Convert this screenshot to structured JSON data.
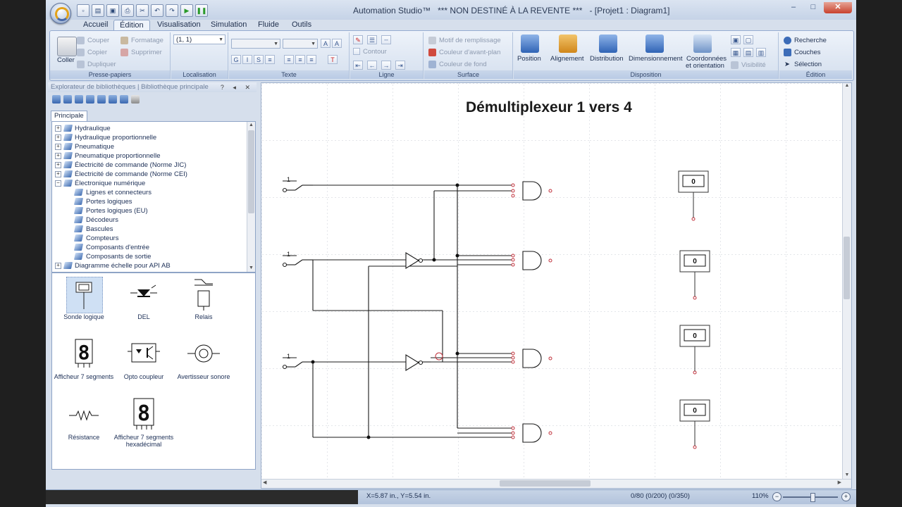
{
  "window": {
    "title": "Automation Studio™   *** NON DESTINÉ À LA REVENTE ***   - [Projet1 : Diagram1]",
    "controls": [
      "–",
      "□",
      "✕"
    ]
  },
  "tabs": [
    "Accueil",
    "Édition",
    "Visualisation",
    "Simulation",
    "Fluide",
    "Outils"
  ],
  "active_tab": "Édition",
  "ribbon": {
    "clipboard": {
      "label": "Presse-papiers",
      "paste": "Coller",
      "cut": "Couper",
      "copy": "Copier",
      "duplicate": "Dupliquer",
      "format": "Formatage",
      "delete": "Supprimer"
    },
    "location": {
      "label": "Localisation",
      "value": "(1, 1)"
    },
    "text": {
      "label": "Texte"
    },
    "line": {
      "label": "Ligne",
      "contour": "Contour"
    },
    "surface": {
      "label": "Surface",
      "fill_pattern": "Motif de remplissage",
      "foreground": "Couleur d'avant-plan",
      "background": "Couleur de fond"
    },
    "layout": {
      "label": "Disposition",
      "position": "Position",
      "alignment": "Alignement",
      "distribution": "Distribution",
      "sizing": "Dimensionnement",
      "coords_1": "Coordonnées",
      "coords_2": "et orientation",
      "visibility": "Visibilité"
    },
    "edition": {
      "label": "Édition",
      "search": "Recherche",
      "layers": "Couches",
      "selection": "Sélection"
    }
  },
  "library": {
    "header": "Explorateur de bibliothèques | Bibliothèque principale",
    "tab": "Principale",
    "tree": [
      {
        "label": "Hydraulique",
        "level": 0,
        "expanded": false
      },
      {
        "label": "Hydraulique proportionnelle",
        "level": 0,
        "expanded": false
      },
      {
        "label": "Pneumatique",
        "level": 0,
        "expanded": false
      },
      {
        "label": "Pneumatique proportionnelle",
        "level": 0,
        "expanded": false
      },
      {
        "label": "Électricité de commande (Norme JIC)",
        "level": 0,
        "expanded": false
      },
      {
        "label": "Électricité de commande (Norme CEI)",
        "level": 0,
        "expanded": false
      },
      {
        "label": "Électronique numérique",
        "level": 0,
        "expanded": true
      },
      {
        "label": "Lignes et connecteurs",
        "level": 1
      },
      {
        "label": "Portes logiques",
        "level": 1
      },
      {
        "label": "Portes logiques (EU)",
        "level": 1
      },
      {
        "label": "Décodeurs",
        "level": 1
      },
      {
        "label": "Bascules",
        "level": 1
      },
      {
        "label": "Compteurs",
        "level": 1
      },
      {
        "label": "Composants d'entrée",
        "level": 1
      },
      {
        "label": "Composants de sortie",
        "level": 1
      },
      {
        "label": "Diagramme échelle pour API AB",
        "level": 0,
        "expanded": false
      }
    ],
    "components": [
      {
        "label": "Sonde logique",
        "icon": "logic-probe-icon"
      },
      {
        "label": "DEL",
        "icon": "led-icon"
      },
      {
        "label": "Relais",
        "icon": "relay-icon"
      },
      {
        "label": "Afficheur 7 segments",
        "icon": "seven-segment-icon"
      },
      {
        "label": "Opto coupleur",
        "icon": "optocoupler-icon"
      },
      {
        "label": "Avertisseur sonore",
        "icon": "buzzer-icon"
      },
      {
        "label": "Résistance",
        "icon": "resistor-icon"
      },
      {
        "label": "Afficheur 7 segments hexadécimal",
        "icon": "hex-display-icon"
      }
    ]
  },
  "diagram": {
    "title": "Démultiplexeur 1 vers 4",
    "probe_values": [
      "0",
      "0",
      "0",
      "0"
    ],
    "switch_labels": [
      "1",
      "1",
      "1"
    ]
  },
  "status": {
    "coords": "X=5.87 in., Y=5.54 in.",
    "counts": "0/80 (0/200) (0/350)",
    "zoom": "110%"
  },
  "colors": {
    "accent": "#2e63b8",
    "wire": "#1a1a1a",
    "pin": "#c0303a",
    "grid": "#c8ccd4"
  }
}
